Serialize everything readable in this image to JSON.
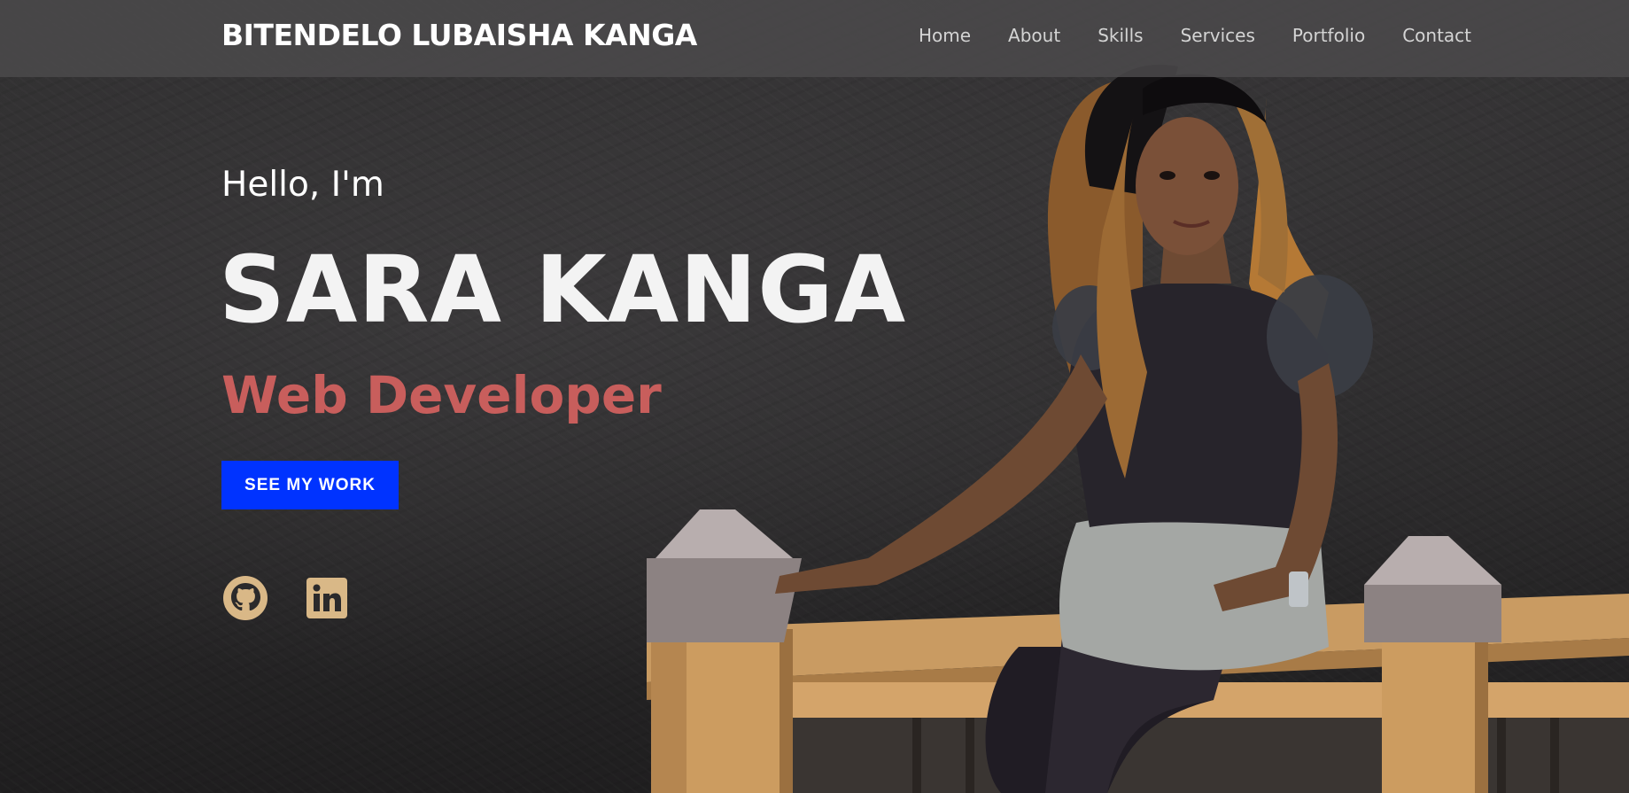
{
  "header": {
    "brand": "BITENDELO LUBAISHA KANGA",
    "nav": [
      "Home",
      "About",
      "Skills",
      "Services",
      "Portfolio",
      "Contact"
    ]
  },
  "hero": {
    "greeting": "Hello, I'm",
    "name": "SARA KANGA",
    "role": "Web Developer",
    "cta_label": "SEE MY WORK"
  },
  "social": [
    {
      "icon": "github-icon"
    },
    {
      "icon": "linkedin-icon"
    }
  ],
  "colors": {
    "accent_text": "#c85e5c",
    "button_bg": "#0033ff",
    "social_icon": "#d9b887",
    "navbar_bg": "#4b4a4b",
    "background": "#2b2a2b"
  }
}
